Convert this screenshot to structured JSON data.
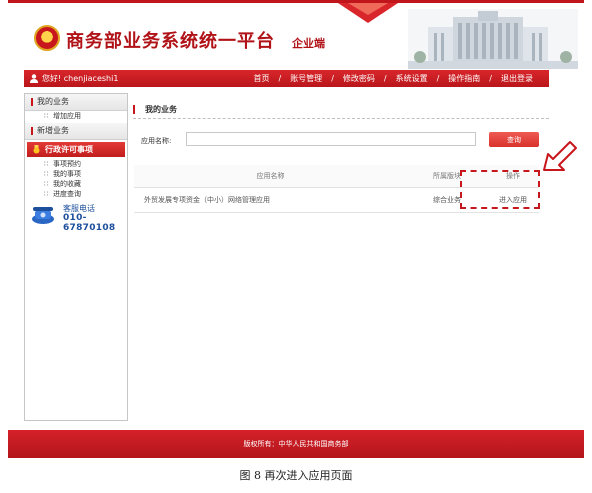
{
  "header": {
    "title": "商务部业务系统统一平台",
    "subtitle": "企业端"
  },
  "topbar": {
    "greeting": "您好! chenjiaceshi1",
    "nav": [
      "首页",
      "账号管理",
      "修改密码",
      "系统设置",
      "操作指南",
      "退出登录"
    ]
  },
  "sidebar": {
    "section1": "我的业务",
    "section1_items": [
      "增加应用"
    ],
    "section2": "新增业务",
    "active_item": "行政许可事项",
    "section2_items": [
      "事项预约",
      "我的事项",
      "我的收藏",
      "进度查询"
    ],
    "hotline_label": "客服电话",
    "hotline_number": "010-67870108"
  },
  "main": {
    "title": "我的业务",
    "search_label": "应用名称:",
    "search_value": "",
    "search_button": "查询",
    "table": {
      "headers": [
        "应用名称",
        "所属版块",
        "操作"
      ],
      "rows": [
        [
          "外贸发展专项资金（中小）网络管理应用",
          "综合业务",
          "进入应用"
        ]
      ]
    }
  },
  "footer": {
    "text": "版权所有：中华人民共和国商务部"
  },
  "caption": "图 8 再次进入应用页面",
  "colors": {
    "brand_red": "#c8161d",
    "hotline_blue": "#1c4f9c"
  }
}
